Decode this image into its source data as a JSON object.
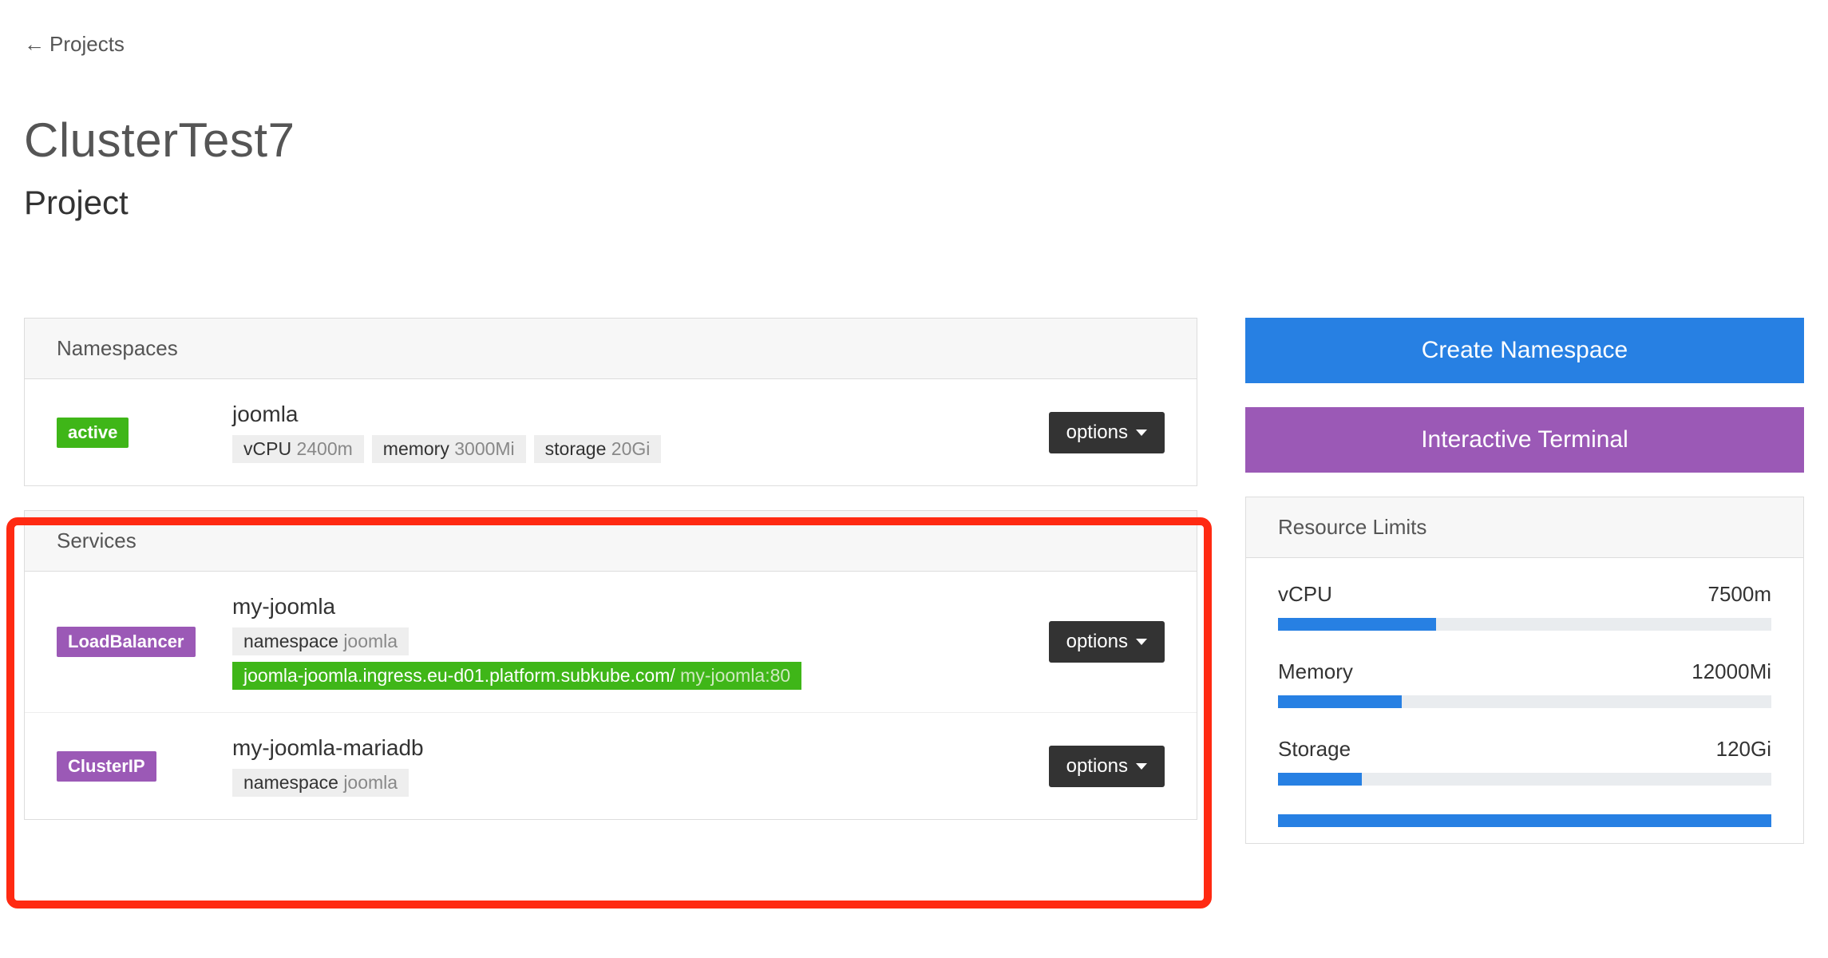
{
  "nav": {
    "back_label": "Projects",
    "back_arrow": "←"
  },
  "header": {
    "cluster_name": "ClusterTest7",
    "subtitle": "Project"
  },
  "namespaces": {
    "title": "Namespaces",
    "items": [
      {
        "status": "active",
        "name": "joomla",
        "resources": [
          {
            "label": "vCPU",
            "value": "2400m"
          },
          {
            "label": "memory",
            "value": "3000Mi"
          },
          {
            "label": "storage",
            "value": "20Gi"
          }
        ],
        "options_label": "options"
      }
    ]
  },
  "services": {
    "title": "Services",
    "items": [
      {
        "type": "LoadBalancer",
        "name": "my-joomla",
        "namespace_label": "namespace",
        "namespace_value": "joomla",
        "ingress_host": "joomla-joomla.ingress.eu-d01.platform.subkube.com/",
        "ingress_target": "my-joomla:80",
        "options_label": "options"
      },
      {
        "type": "ClusterIP",
        "name": "my-joomla-mariadb",
        "namespace_label": "namespace",
        "namespace_value": "joomla",
        "options_label": "options"
      }
    ]
  },
  "actions": {
    "create_namespace": "Create Namespace",
    "interactive_terminal": "Interactive Terminal"
  },
  "limits": {
    "title": "Resource Limits",
    "rows": [
      {
        "label": "vCPU",
        "value": "7500m"
      },
      {
        "label": "Memory",
        "value": "12000Mi"
      },
      {
        "label": "Storage",
        "value": "120Gi"
      }
    ]
  }
}
